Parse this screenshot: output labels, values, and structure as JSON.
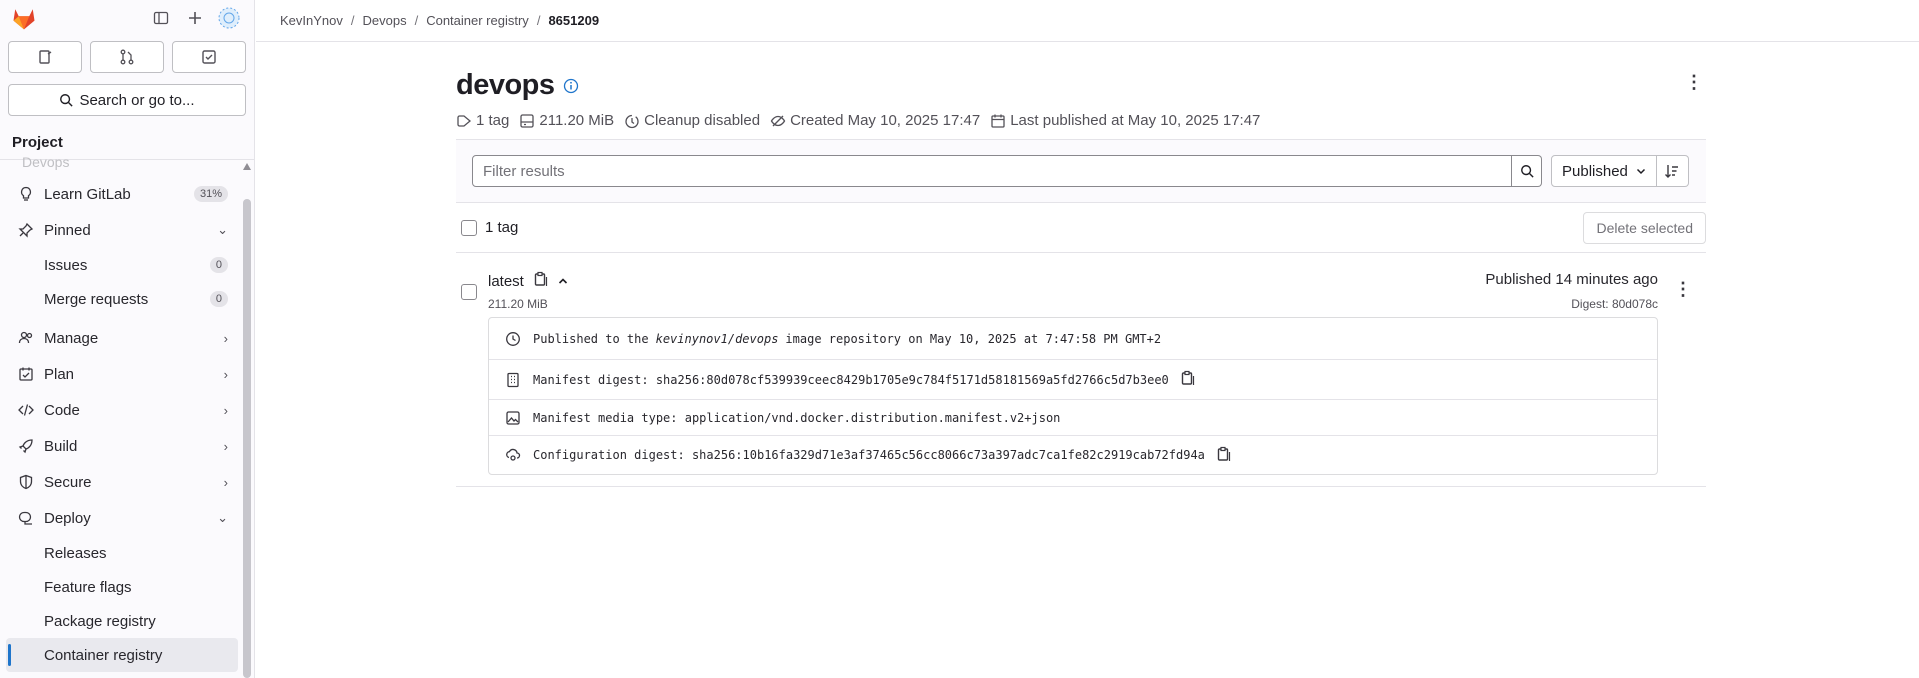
{
  "sidebar": {
    "section_title": "Project",
    "search_label": "Search or go to...",
    "faded_item": "Devops",
    "items": [
      {
        "label": "Learn GitLab",
        "badge": "31%"
      },
      {
        "label": "Pinned"
      },
      {
        "label": "Manage"
      },
      {
        "label": "Plan"
      },
      {
        "label": "Code"
      },
      {
        "label": "Build"
      },
      {
        "label": "Secure"
      },
      {
        "label": "Deploy"
      }
    ],
    "pinned_sub": [
      {
        "label": "Issues",
        "count": "0"
      },
      {
        "label": "Merge requests",
        "count": "0"
      }
    ],
    "deploy_sub": [
      {
        "label": "Releases"
      },
      {
        "label": "Feature flags"
      },
      {
        "label": "Package registry"
      },
      {
        "label": "Container registry"
      }
    ]
  },
  "breadcrumb": [
    "KevInYnov",
    "Devops",
    "Container registry",
    "8651209"
  ],
  "page": {
    "title": "devops",
    "meta": {
      "tags": "1 tag",
      "size": "211.20 MiB",
      "cleanup": "Cleanup disabled",
      "created": "Created May 10, 2025 17:47",
      "published": "Last published at May 10, 2025 17:47"
    }
  },
  "filter": {
    "placeholder": "Filter results",
    "sort_label": "Published"
  },
  "tags_header": {
    "count_label": "1 tag",
    "delete_label": "Delete selected"
  },
  "tag": {
    "name": "latest",
    "size": "211.20 MiB",
    "published": "Published 14 minutes ago",
    "digest": "Digest: 80d078c",
    "details": {
      "published_pre": "Published to the",
      "repo": "kevinynov1/devops",
      "published_post": "image repository on May 10, 2025 at 7:47:58 PM GMT+2",
      "manifest_digest": "Manifest digest: sha256:80d078cf539939ceec8429b1705e9c784f5171d58181569a5fd2766c5d7b3ee0",
      "media_type": "Manifest media type: application/vnd.docker.distribution.manifest.v2+json",
      "config_digest": "Configuration digest: sha256:10b16fa329d71e3af37465c56cc8066c73a397adc7ca1fe82c2919cab72fd94a"
    }
  }
}
